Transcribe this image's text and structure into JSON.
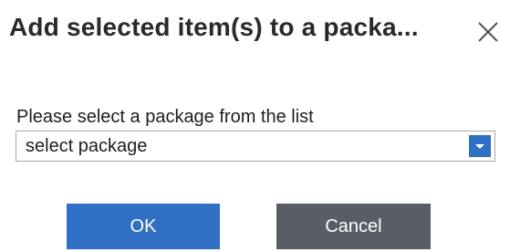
{
  "dialog": {
    "title": "Add selected item(s) to a packa...",
    "close_icon": "close-icon"
  },
  "form": {
    "prompt": "Please select a package from the list",
    "select_value": "select package",
    "dropdown_icon": "chevron-down-icon"
  },
  "buttons": {
    "ok_label": "OK",
    "cancel_label": "Cancel"
  },
  "colors": {
    "primary": "#2f6fc4",
    "secondary": "#595e66",
    "title_text": "#2a2a2a"
  }
}
